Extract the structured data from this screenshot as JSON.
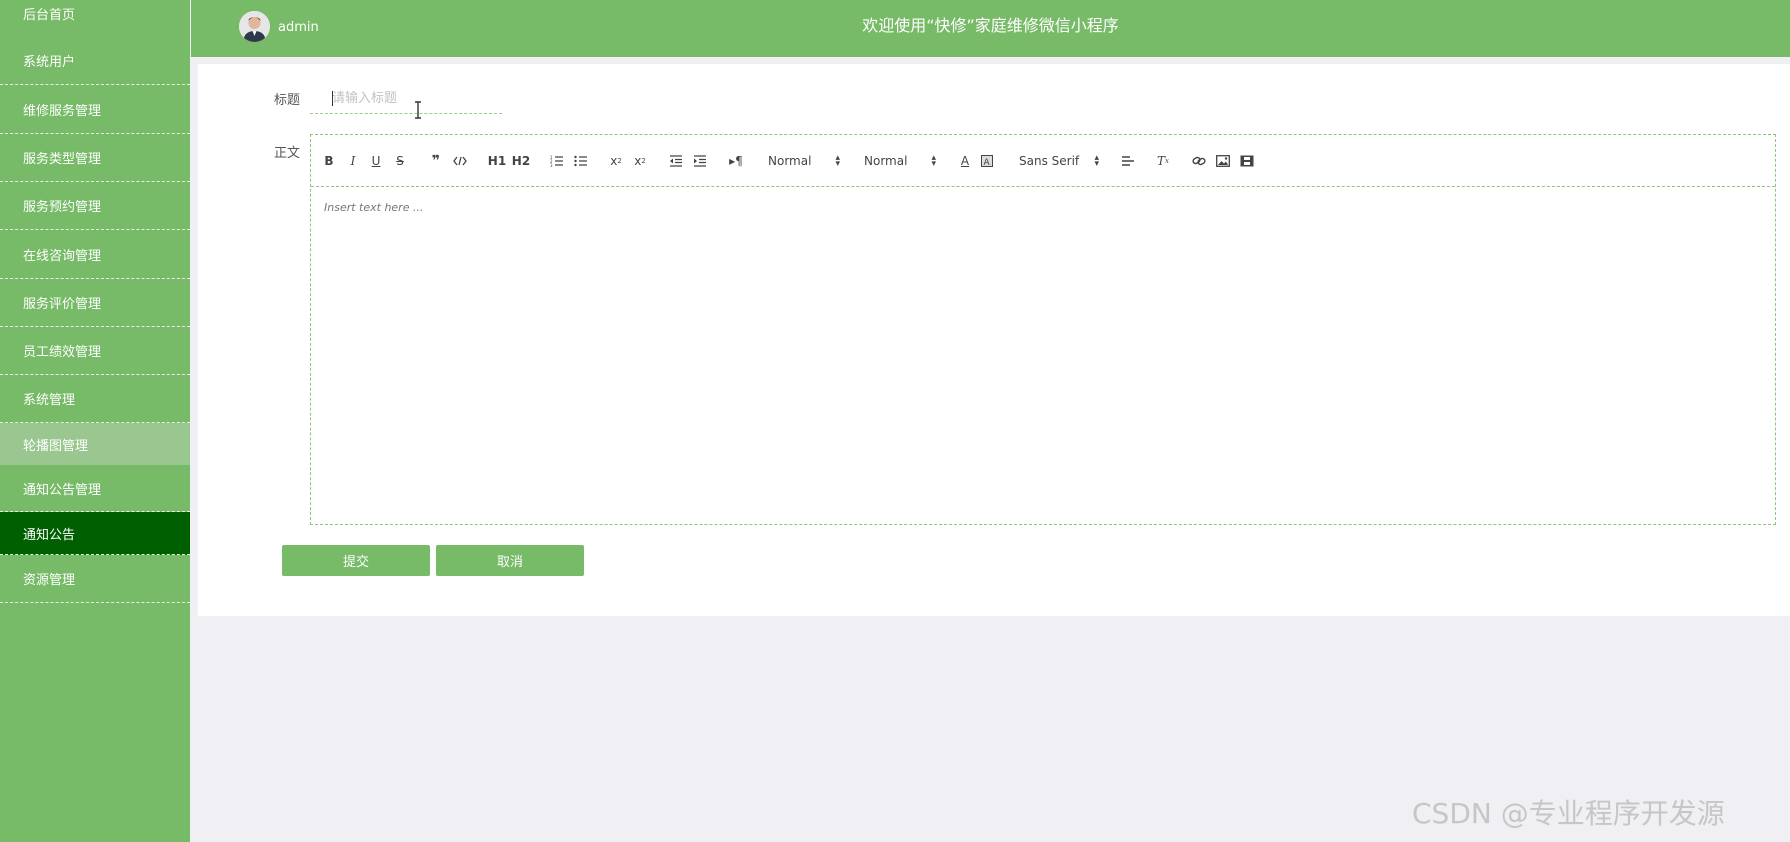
{
  "sidebar": {
    "items": [
      {
        "label": "后台首页"
      },
      {
        "label": "系统用户"
      },
      {
        "label": "维修服务管理"
      },
      {
        "label": "服务类型管理"
      },
      {
        "label": "服务预约管理"
      },
      {
        "label": "在线咨询管理"
      },
      {
        "label": "服务评价管理"
      },
      {
        "label": "员工绩效管理"
      },
      {
        "label": "系统管理"
      },
      {
        "label": "轮播图管理"
      },
      {
        "label": "通知公告管理"
      },
      {
        "label": "通知公告"
      },
      {
        "label": "资源管理"
      }
    ]
  },
  "header": {
    "username": "admin",
    "title": "欢迎使用“快修”家庭维修微信小程序"
  },
  "form": {
    "title_label": "标题",
    "title_placeholder": "请输入标题",
    "title_value": "",
    "content_label": "正文",
    "editor_placeholder": "Insert text here ...",
    "toolbar": {
      "size_select": "Normal",
      "header_select": "Normal",
      "font_select": "Sans Serif",
      "h1": "H1",
      "h2": "H2"
    },
    "submit_label": "提交",
    "cancel_label": "取消"
  },
  "watermark": "CSDN @专业程序开发源",
  "colors": {
    "primary_green": "#77ba67",
    "active_green": "#005f00",
    "hover_green": "#9ac78f",
    "background": "#efeff4"
  }
}
